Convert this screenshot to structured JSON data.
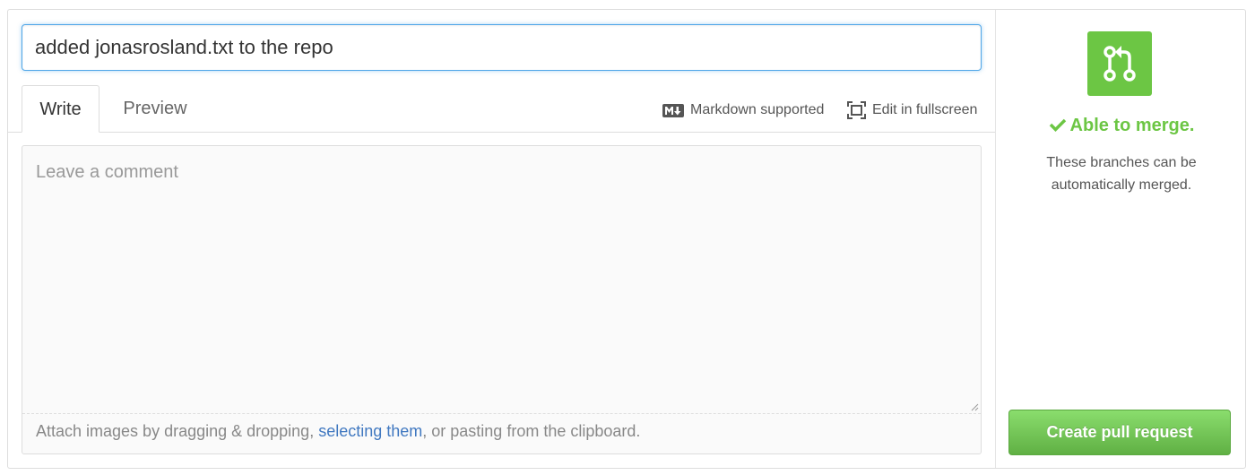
{
  "title_input": {
    "value": "added jonasrosland.txt to the repo"
  },
  "tabs": [
    {
      "label": "Write",
      "active": true
    },
    {
      "label": "Preview",
      "active": false
    }
  ],
  "toolbar": {
    "markdown_label": "Markdown supported",
    "markdown_icon": "markdown-icon",
    "fullscreen_label": "Edit in fullscreen",
    "fullscreen_icon": "fullscreen-icon"
  },
  "comment": {
    "placeholder": "Leave a comment",
    "value": "",
    "attach_prefix": "Attach images by dragging & dropping, ",
    "attach_link": "selecting them",
    "attach_suffix": ", or pasting from the clipboard."
  },
  "merge": {
    "icon": "git-pull-request-icon",
    "status_icon": "check-icon",
    "status": "Able to merge.",
    "description_line1": "These branches can be",
    "description_line2": "automatically merged.",
    "create_button_label": "Create pull request"
  },
  "colors": {
    "accent_green": "#6cc644",
    "link_blue": "#4078c0",
    "focus_blue": "#51a7e8"
  }
}
